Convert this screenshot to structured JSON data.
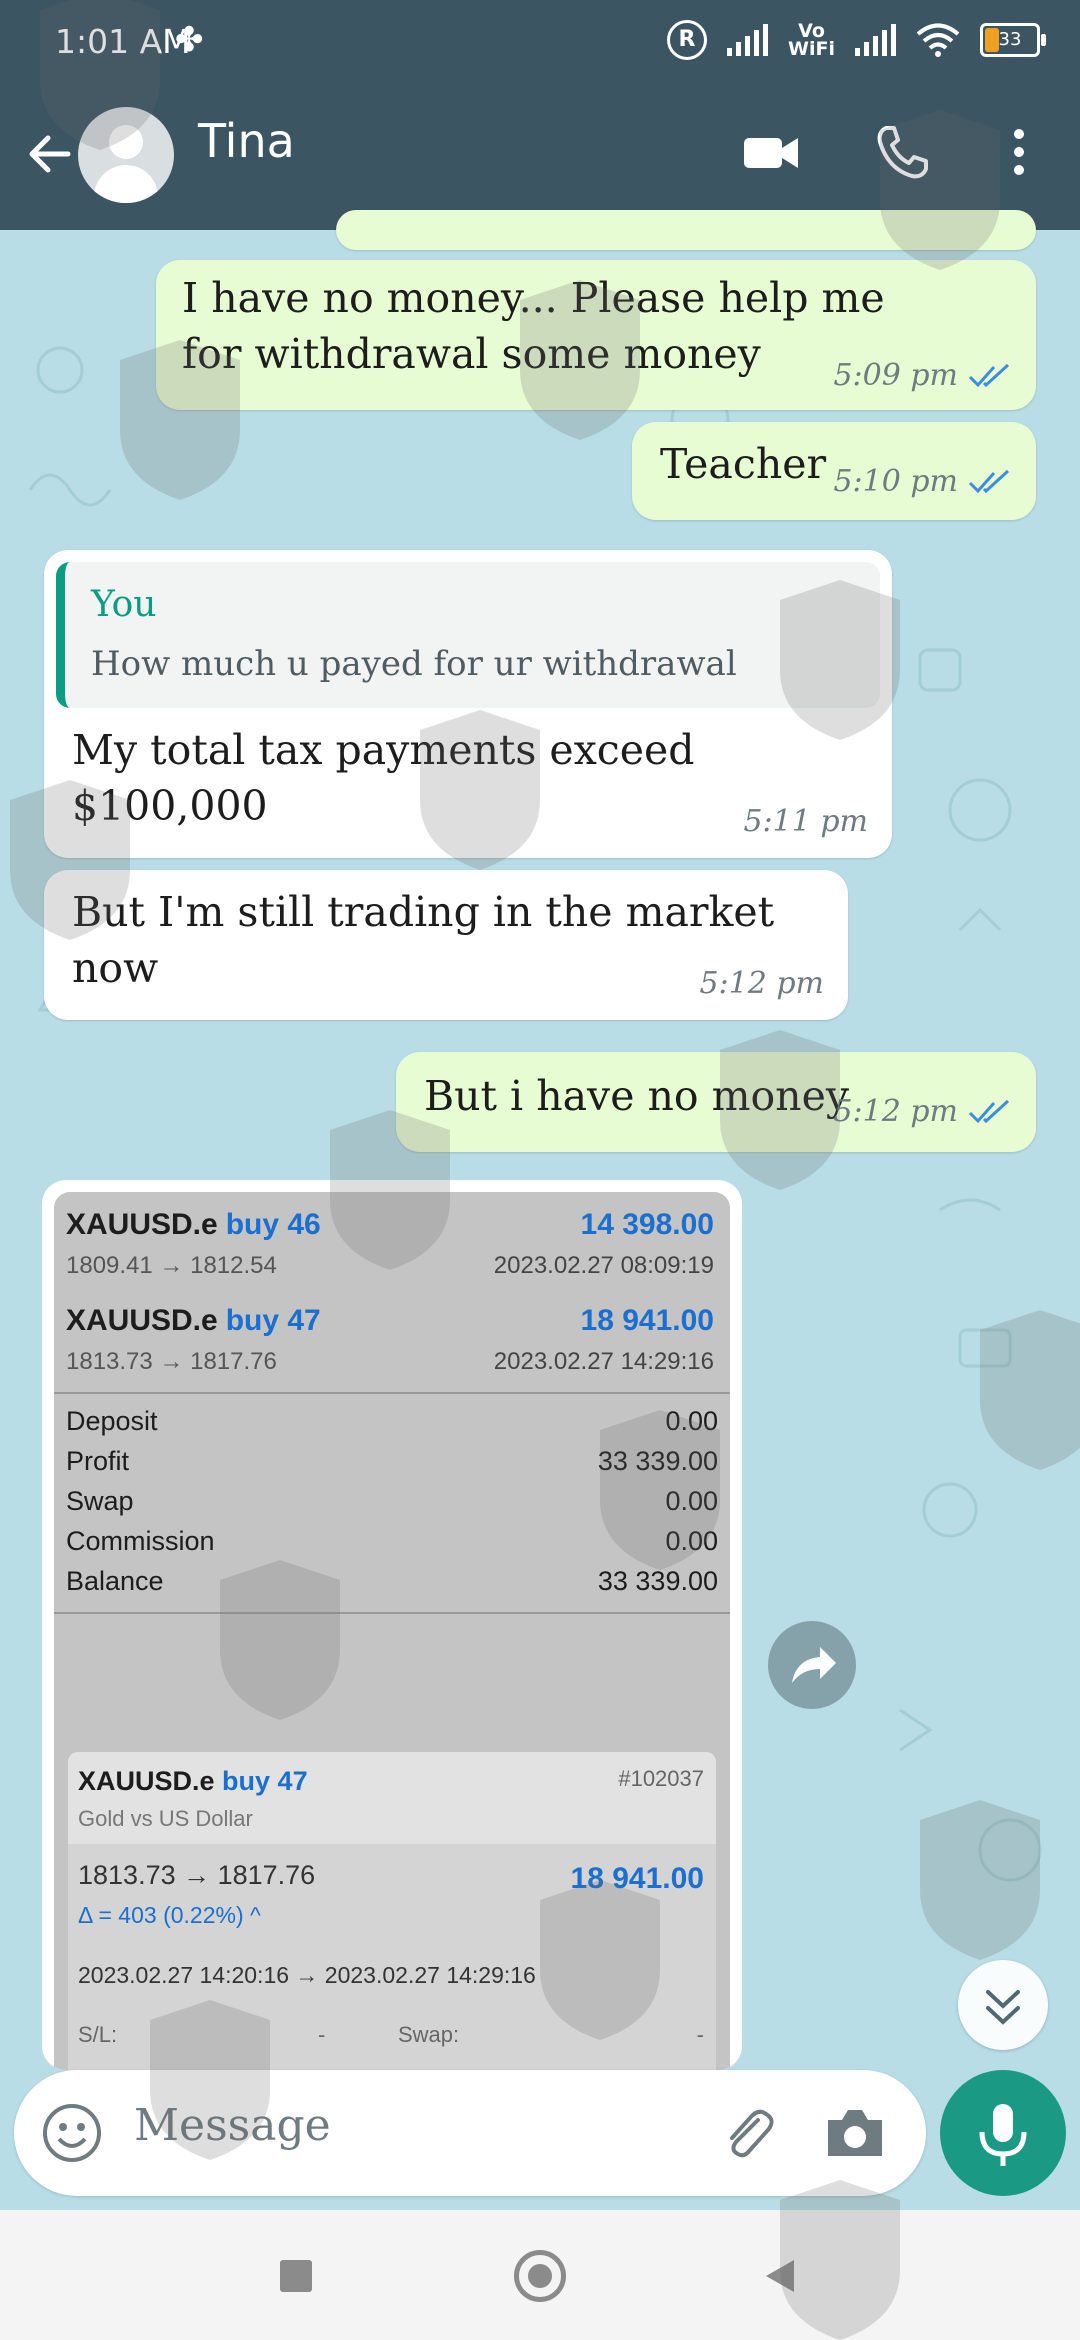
{
  "status_bar": {
    "time": "1:01 AM",
    "registered_mark": "R",
    "vowifi_line1": "Vo",
    "vowifi_line2": "WiFi",
    "battery": "33"
  },
  "header": {
    "contact_name": "Tina"
  },
  "messages": [
    {
      "id": "m1",
      "direction": "outgoing",
      "text": "I have no money... Please help me for withdrawal some money",
      "time": "5:09 pm",
      "status": "read"
    },
    {
      "id": "m2",
      "direction": "outgoing",
      "text": "Teacher",
      "time": "5:10 pm",
      "status": "read"
    },
    {
      "id": "m3",
      "direction": "incoming",
      "quote_author": "You",
      "quote_text": "How much u payed for ur withdrawal",
      "text": "My total tax payments exceed $100,000",
      "time": "5:11 pm"
    },
    {
      "id": "m4",
      "direction": "incoming",
      "text": "But I'm still trading in the market now",
      "time": "5:12 pm"
    },
    {
      "id": "m5",
      "direction": "outgoing",
      "text": "But i have no money",
      "time": "5:12 pm",
      "status": "read"
    }
  ],
  "image_message": {
    "trades": [
      {
        "symbol": "XAUUSD.e",
        "action": "buy 46",
        "prices": "1809.41 → 1812.54",
        "profit": "14 398.00",
        "datetime": "2023.02.27 08:09:19"
      },
      {
        "symbol": "XAUUSD.e",
        "action": "buy 47",
        "prices": "1813.73 → 1817.76",
        "profit": "18 941.00",
        "datetime": "2023.02.27 14:29:16"
      }
    ],
    "summary": [
      {
        "label": "Deposit",
        "value": "0.00"
      },
      {
        "label": "Profit",
        "value": "33 339.00"
      },
      {
        "label": "Swap",
        "value": "0.00"
      },
      {
        "label": "Commission",
        "value": "0.00"
      },
      {
        "label": "Balance",
        "value": "33 339.00"
      }
    ],
    "detail": {
      "symbol": "XAUUSD.e",
      "action": "buy 47",
      "ticket": "#102037",
      "description": "Gold vs US Dollar",
      "prices": "1813.73 → 1817.76",
      "profit": "18 941.00",
      "delta": "Δ = 403 (0.22%) ^",
      "period": "2023.02.27 14:20:16 → 2023.02.27 14:29:16",
      "sl_label": "S/L:",
      "sl_value": "-",
      "swap_label": "Swap:",
      "swap_value": "-"
    }
  },
  "composer": {
    "placeholder": "Message"
  },
  "colors": {
    "header_bg": "#3b5563",
    "chat_bg": "#b8dde6",
    "outgoing_bubble": "#e7fcd3",
    "incoming_bubble": "#ffffff",
    "accent_green": "#1a9a84",
    "read_ticks": "#3b8de0"
  },
  "icons": [
    "back-arrow-icon",
    "video-call-icon",
    "phone-icon",
    "more-vert-icon",
    "emoji-icon",
    "attach-icon",
    "camera-icon",
    "mic-icon",
    "share-icon",
    "scroll-down-icon",
    "nav-recent-icon",
    "nav-home-icon",
    "nav-back-icon"
  ]
}
